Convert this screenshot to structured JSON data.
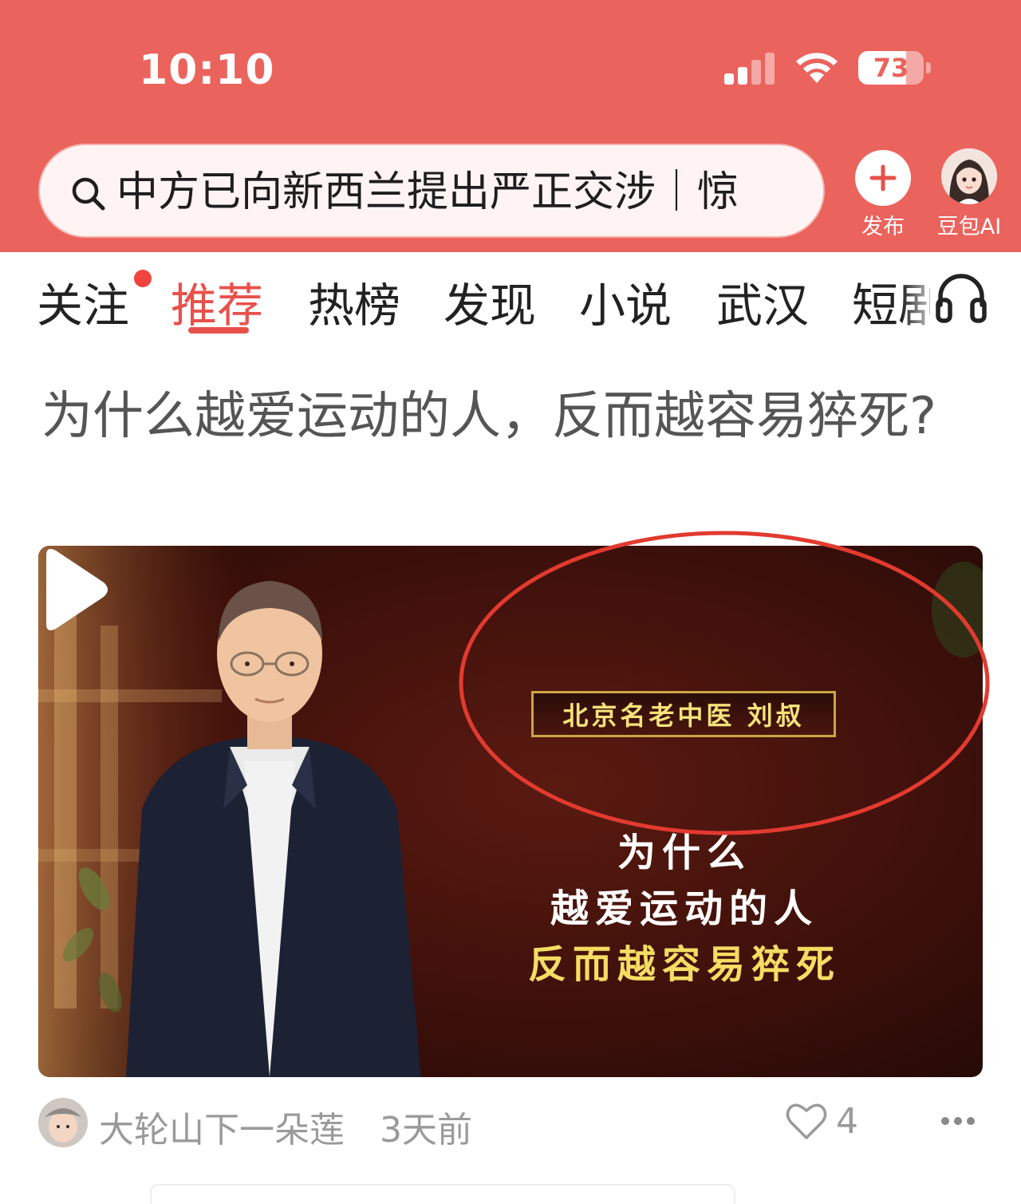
{
  "status_bar": {
    "time": "10:10",
    "battery": "73",
    "battery_level": 0.73
  },
  "header": {
    "search_text": "中方已向新西兰提出严正交涉｜惊",
    "publish_label": "发布",
    "ai_label": "豆包AI",
    "background_color": "#eb635d"
  },
  "tabs": [
    {
      "label": "关注",
      "has_dot": true
    },
    {
      "label": "推荐",
      "active": true
    },
    {
      "label": "热榜"
    },
    {
      "label": "发现"
    },
    {
      "label": "小说"
    },
    {
      "label": "武汉"
    },
    {
      "label": "短剧"
    }
  ],
  "article": {
    "title": "为什么越爱运动的人，反而越容易猝死?",
    "video": {
      "name_plate": "北京名老中医 刘叔",
      "caption_line1": "为什么",
      "caption_line2": "越爱运动的人",
      "caption_line3": "反而越容易猝死"
    },
    "author": "大轮山下一朵莲",
    "time": "3天前",
    "likes": "4"
  },
  "icons": [
    "search-icon",
    "plus-icon",
    "headphone-icon",
    "play-icon",
    "heart-icon",
    "more-icon"
  ],
  "accent_color": "#e8514b"
}
